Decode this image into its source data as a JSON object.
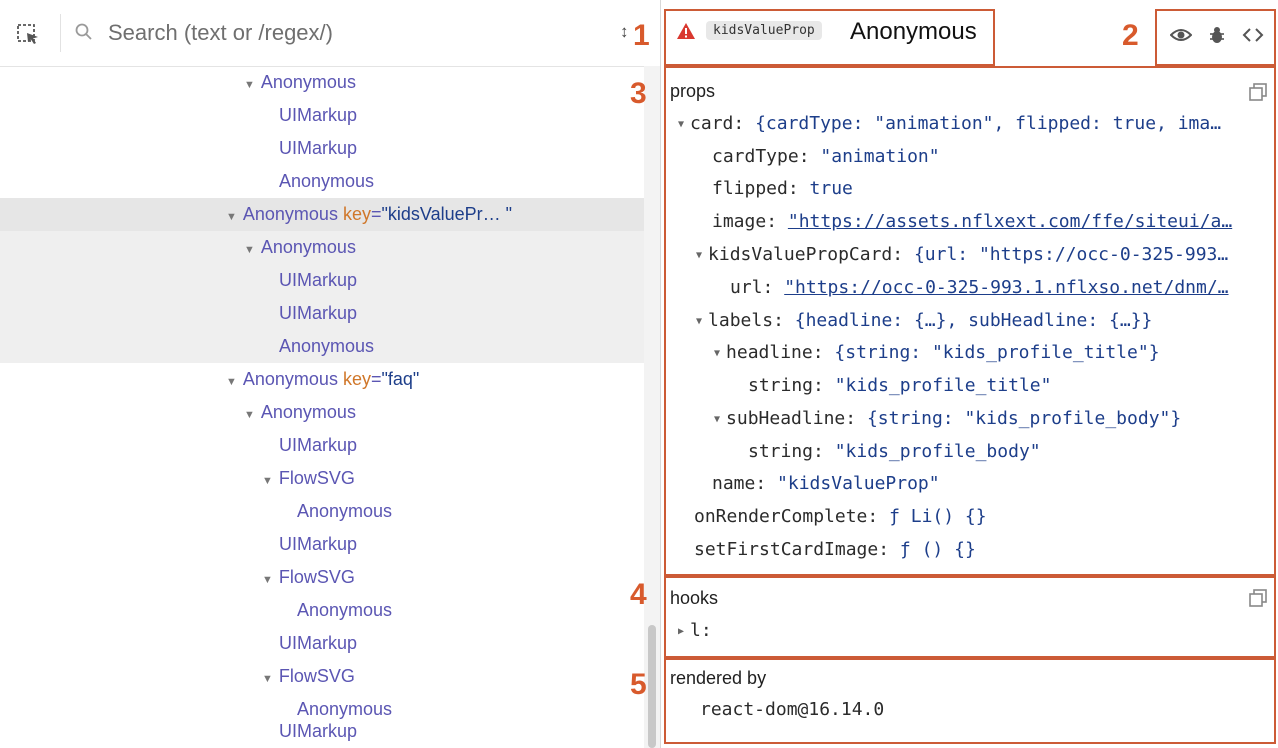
{
  "toolbar": {
    "search_placeholder": "Search (text or /regex/)",
    "sort_label": "↕"
  },
  "tree": [
    {
      "name": "Anonymous",
      "expanded": true
    },
    {
      "name": "UIMarkup"
    },
    {
      "name": "UIMarkup"
    },
    {
      "name": "Anonymous"
    },
    {
      "name": "Anonymous",
      "key_attr": "key",
      "key_value": "\"kidsValuePr… \"",
      "expanded": true,
      "selected": true
    },
    {
      "name": "Anonymous",
      "expanded": true
    },
    {
      "name": "UIMarkup"
    },
    {
      "name": "UIMarkup"
    },
    {
      "name": "Anonymous"
    },
    {
      "name": "Anonymous",
      "key_attr": "key",
      "key_value": "\"faq\"",
      "expanded": true
    },
    {
      "name": "Anonymous",
      "expanded": true
    },
    {
      "name": "UIMarkup"
    },
    {
      "name": "FlowSVG",
      "expanded": true
    },
    {
      "name": "Anonymous"
    },
    {
      "name": "UIMarkup"
    },
    {
      "name": "FlowSVG",
      "expanded": true
    },
    {
      "name": "Anonymous"
    },
    {
      "name": "UIMarkup"
    },
    {
      "name": "FlowSVG",
      "expanded": true
    },
    {
      "name": "Anonymous"
    },
    {
      "name": "UIMarkup"
    }
  ],
  "header": {
    "badge": "kidsValueProp",
    "component_name": "Anonymous",
    "icons": [
      "eye-icon",
      "bug-icon",
      "code-icon"
    ]
  },
  "callouts": [
    "1",
    "2",
    "3",
    "4",
    "5"
  ],
  "props": {
    "title": "props",
    "lines": [
      {
        "key": "card",
        "sep": ": ",
        "value": "{cardType: \"animation\", flipped: true, ima…",
        "type": "o",
        "twisty": true
      },
      {
        "key": "cardType",
        "sep": ": ",
        "value": "\"animation\"",
        "type": "s"
      },
      {
        "key": "flipped",
        "sep": ": ",
        "value": "true",
        "type": "b"
      },
      {
        "key": "image",
        "sep": ": ",
        "value": "\"https://assets.nflxext.com/ffe/siteui/a…",
        "type": "u"
      },
      {
        "key": "kidsValuePropCard",
        "sep": ": ",
        "value": "{url: \"https://occ-0-325-993…",
        "type": "o",
        "twisty": true
      },
      {
        "key": "url",
        "sep": ": ",
        "value": "\"https://occ-0-325-993.1.nflxso.net/dnm/…",
        "type": "u"
      },
      {
        "key": "labels",
        "sep": ": ",
        "value": "{headline: {…}, subHeadline: {…}}",
        "type": "o",
        "twisty": true
      },
      {
        "key": "headline",
        "sep": ": ",
        "value": "{string: \"kids_profile_title\"}",
        "type": "o",
        "twisty": true
      },
      {
        "key": "string",
        "sep": ": ",
        "value": "\"kids_profile_title\"",
        "type": "s"
      },
      {
        "key": "subHeadline",
        "sep": ": ",
        "value": "{string: \"kids_profile_body\"}",
        "type": "o",
        "twisty": true
      },
      {
        "key": "string",
        "sep": ": ",
        "value": "\"kids_profile_body\"",
        "type": "s"
      },
      {
        "key": "name",
        "sep": ": ",
        "value": "\"kidsValueProp\"",
        "type": "s"
      },
      {
        "key": "onRenderComplete",
        "sep": ": ",
        "value": "ƒ Li() {}",
        "type": "f"
      },
      {
        "key": "setFirstCardImage",
        "sep": ": ",
        "value": "ƒ () {}",
        "type": "f"
      }
    ]
  },
  "hooks": {
    "title": "hooks",
    "items": [
      {
        "key": "l",
        "sep": ":"
      }
    ]
  },
  "rendered_by": {
    "title": "rendered by",
    "value": "react-dom@16.14.0"
  }
}
